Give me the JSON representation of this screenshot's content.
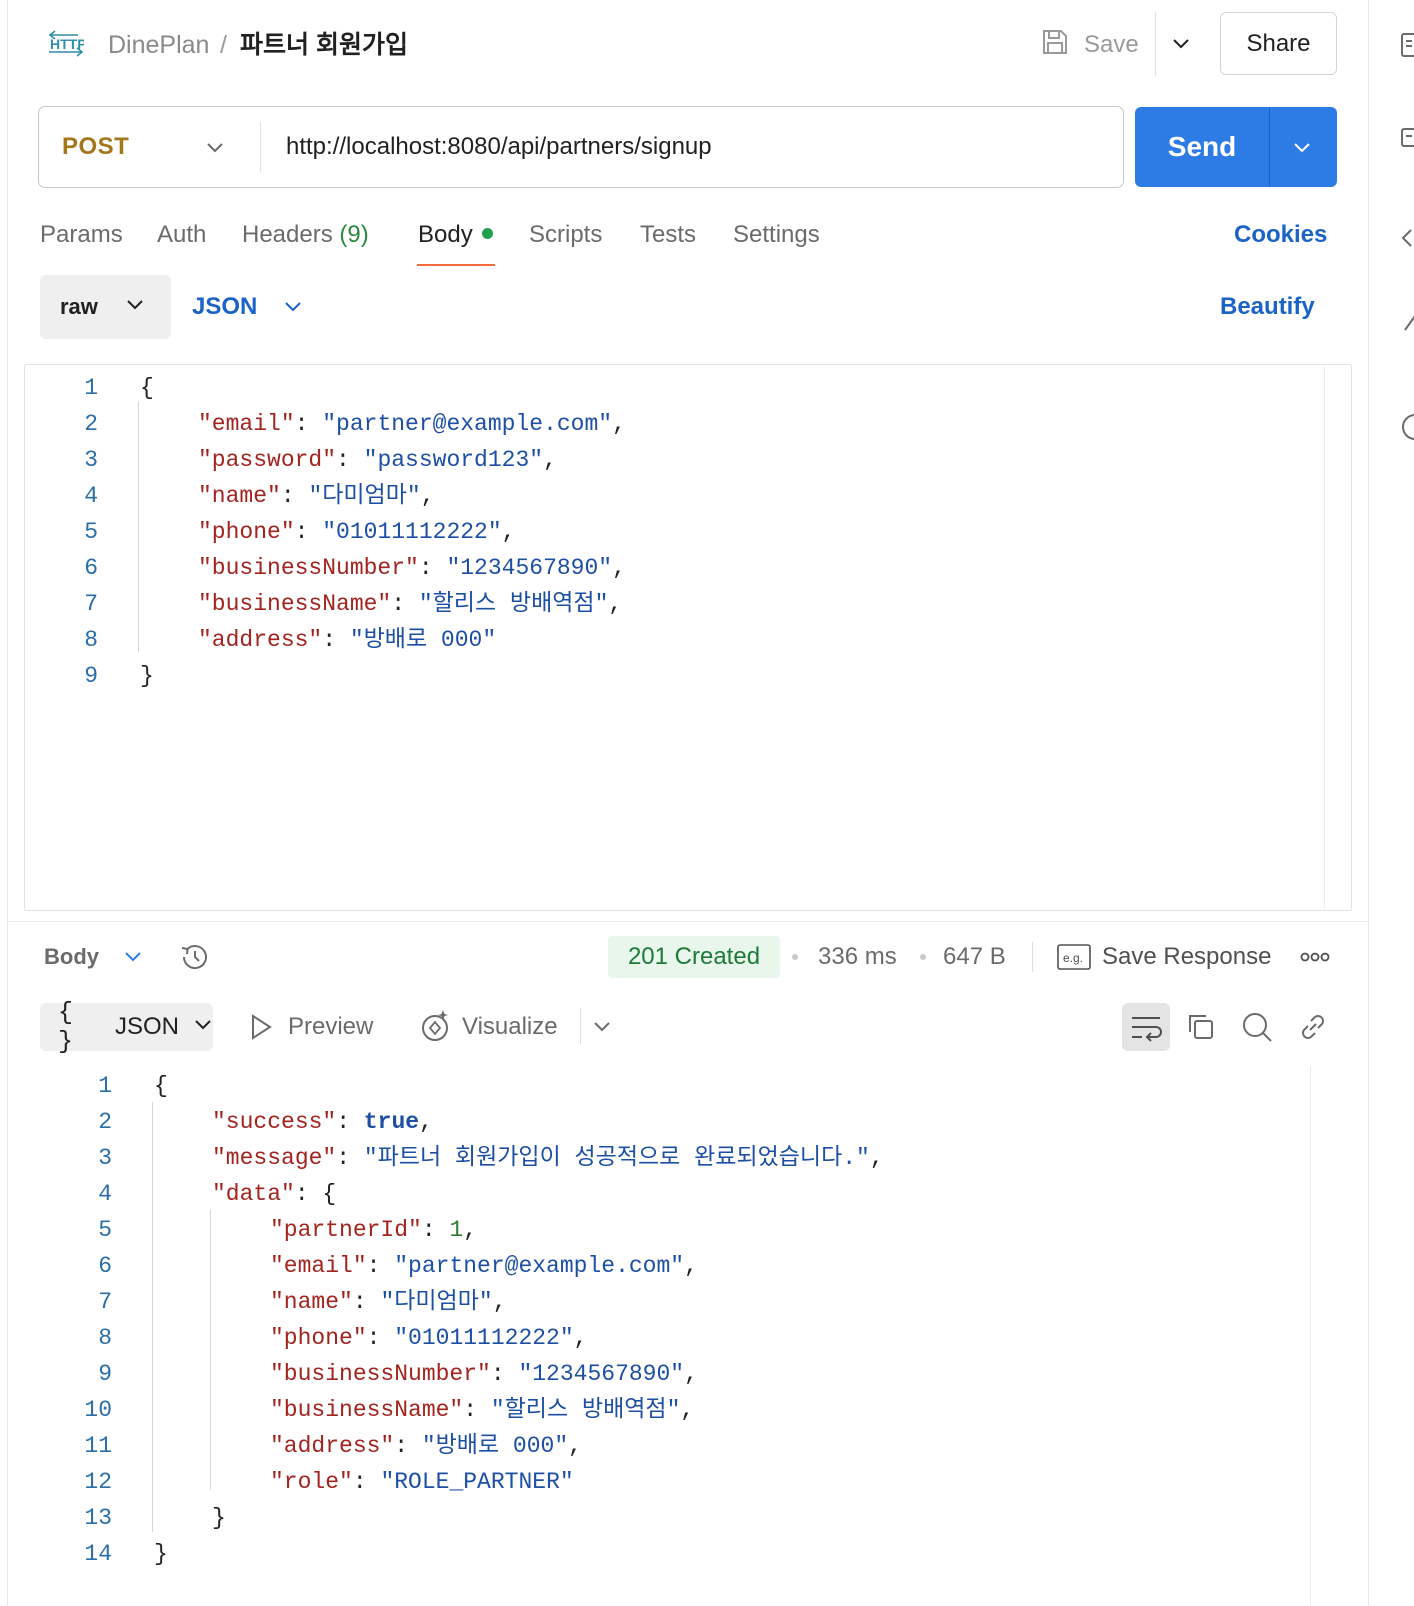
{
  "header": {
    "http_icon_label": "HTTP",
    "collection": "DinePlan",
    "separator": "/",
    "request_name": "파트너 회원가입",
    "save_label": "Save",
    "share_label": "Share"
  },
  "request": {
    "method": "POST",
    "url": "http://localhost:8080/api/partners/signup",
    "send_label": "Send"
  },
  "tabs": {
    "params": "Params",
    "auth": "Auth",
    "headers": "Headers",
    "headers_count": "(9)",
    "body": "Body",
    "scripts": "Scripts",
    "tests": "Tests",
    "settings": "Settings",
    "cookies": "Cookies"
  },
  "body_options": {
    "mode": "raw",
    "language": "JSON",
    "beautify": "Beautify"
  },
  "request_body_lines": [
    {
      "num": "1",
      "indent": 0,
      "parts": [
        {
          "t": "{",
          "c": "p"
        }
      ]
    },
    {
      "num": "2",
      "indent": 1,
      "parts": [
        {
          "t": "\"email\"",
          "c": "k"
        },
        {
          "t": ": ",
          "c": "p"
        },
        {
          "t": "\"partner@example.com\"",
          "c": "s"
        },
        {
          "t": ",",
          "c": "p"
        }
      ]
    },
    {
      "num": "3",
      "indent": 1,
      "parts": [
        {
          "t": "\"password\"",
          "c": "k"
        },
        {
          "t": ": ",
          "c": "p"
        },
        {
          "t": "\"password123\"",
          "c": "s"
        },
        {
          "t": ",",
          "c": "p"
        }
      ]
    },
    {
      "num": "4",
      "indent": 1,
      "parts": [
        {
          "t": "\"name\"",
          "c": "k"
        },
        {
          "t": ": ",
          "c": "p"
        },
        {
          "t": "\"다미엄마\"",
          "c": "s"
        },
        {
          "t": ",",
          "c": "p"
        }
      ]
    },
    {
      "num": "5",
      "indent": 1,
      "parts": [
        {
          "t": "\"phone\"",
          "c": "k"
        },
        {
          "t": ": ",
          "c": "p"
        },
        {
          "t": "\"01011112222\"",
          "c": "s"
        },
        {
          "t": ",",
          "c": "p"
        }
      ]
    },
    {
      "num": "6",
      "indent": 1,
      "parts": [
        {
          "t": "\"businessNumber\"",
          "c": "k"
        },
        {
          "t": ": ",
          "c": "p"
        },
        {
          "t": "\"1234567890\"",
          "c": "s"
        },
        {
          "t": ",",
          "c": "p"
        }
      ]
    },
    {
      "num": "7",
      "indent": 1,
      "parts": [
        {
          "t": "\"businessName\"",
          "c": "k"
        },
        {
          "t": ": ",
          "c": "p"
        },
        {
          "t": "\"할리스 방배역점\"",
          "c": "s"
        },
        {
          "t": ",",
          "c": "p"
        }
      ]
    },
    {
      "num": "8",
      "indent": 1,
      "parts": [
        {
          "t": "\"address\"",
          "c": "k"
        },
        {
          "t": ": ",
          "c": "p"
        },
        {
          "t": "\"방배로 000\"",
          "c": "s"
        }
      ]
    },
    {
      "num": "9",
      "indent": 0,
      "parts": [
        {
          "t": "}",
          "c": "p"
        }
      ]
    }
  ],
  "response": {
    "body_label": "Body",
    "status": "201 Created",
    "time": "336 ms",
    "size": "647 B",
    "eg_label": "e.g.",
    "save_response": "Save Response",
    "view_mode": "JSON",
    "view_braces": "{ }",
    "preview": "Preview",
    "visualize": "Visualize"
  },
  "response_body_lines": [
    {
      "num": "1",
      "indent": 0,
      "parts": [
        {
          "t": "{",
          "c": "p"
        }
      ]
    },
    {
      "num": "2",
      "indent": 1,
      "parts": [
        {
          "t": "\"success\"",
          "c": "k"
        },
        {
          "t": ": ",
          "c": "p"
        },
        {
          "t": "true",
          "c": "b"
        },
        {
          "t": ",",
          "c": "p"
        }
      ]
    },
    {
      "num": "3",
      "indent": 1,
      "parts": [
        {
          "t": "\"message\"",
          "c": "k"
        },
        {
          "t": ": ",
          "c": "p"
        },
        {
          "t": "\"파트너 회원가입이 성공적으로 완료되었습니다.\"",
          "c": "s"
        },
        {
          "t": ",",
          "c": "p"
        }
      ]
    },
    {
      "num": "4",
      "indent": 1,
      "parts": [
        {
          "t": "\"data\"",
          "c": "k"
        },
        {
          "t": ": {",
          "c": "p"
        }
      ]
    },
    {
      "num": "5",
      "indent": 2,
      "parts": [
        {
          "t": "\"partnerId\"",
          "c": "k"
        },
        {
          "t": ": ",
          "c": "p"
        },
        {
          "t": "1",
          "c": "n"
        },
        {
          "t": ",",
          "c": "p"
        }
      ]
    },
    {
      "num": "6",
      "indent": 2,
      "parts": [
        {
          "t": "\"email\"",
          "c": "k"
        },
        {
          "t": ": ",
          "c": "p"
        },
        {
          "t": "\"partner@example.com\"",
          "c": "s"
        },
        {
          "t": ",",
          "c": "p"
        }
      ]
    },
    {
      "num": "7",
      "indent": 2,
      "parts": [
        {
          "t": "\"name\"",
          "c": "k"
        },
        {
          "t": ": ",
          "c": "p"
        },
        {
          "t": "\"다미엄마\"",
          "c": "s"
        },
        {
          "t": ",",
          "c": "p"
        }
      ]
    },
    {
      "num": "8",
      "indent": 2,
      "parts": [
        {
          "t": "\"phone\"",
          "c": "k"
        },
        {
          "t": ": ",
          "c": "p"
        },
        {
          "t": "\"01011112222\"",
          "c": "s"
        },
        {
          "t": ",",
          "c": "p"
        }
      ]
    },
    {
      "num": "9",
      "indent": 2,
      "parts": [
        {
          "t": "\"businessNumber\"",
          "c": "k"
        },
        {
          "t": ": ",
          "c": "p"
        },
        {
          "t": "\"1234567890\"",
          "c": "s"
        },
        {
          "t": ",",
          "c": "p"
        }
      ]
    },
    {
      "num": "10",
      "indent": 2,
      "parts": [
        {
          "t": "\"businessName\"",
          "c": "k"
        },
        {
          "t": ": ",
          "c": "p"
        },
        {
          "t": "\"할리스 방배역점\"",
          "c": "s"
        },
        {
          "t": ",",
          "c": "p"
        }
      ]
    },
    {
      "num": "11",
      "indent": 2,
      "parts": [
        {
          "t": "\"address\"",
          "c": "k"
        },
        {
          "t": ": ",
          "c": "p"
        },
        {
          "t": "\"방배로 000\"",
          "c": "s"
        },
        {
          "t": ",",
          "c": "p"
        }
      ]
    },
    {
      "num": "12",
      "indent": 2,
      "parts": [
        {
          "t": "\"role\"",
          "c": "k"
        },
        {
          "t": ": ",
          "c": "p"
        },
        {
          "t": "\"ROLE_PARTNER\"",
          "c": "s"
        }
      ]
    },
    {
      "num": "13",
      "indent": 1,
      "parts": [
        {
          "t": "}",
          "c": "p"
        }
      ]
    },
    {
      "num": "14",
      "indent": 0,
      "parts": [
        {
          "t": "}",
          "c": "p"
        }
      ]
    }
  ],
  "icons": {
    "http": "http-request-icon",
    "save": "floppy-disk-icon",
    "chevron": "chevron-down-icon",
    "history": "history-clock-icon",
    "save_response": "eg-example-icon",
    "more": "more-horizontal-icon",
    "preview": "play-triangle-icon",
    "visualize": "visualize-sparkle-icon",
    "wrap": "wrap-lines-icon",
    "copy": "copy-icon",
    "search": "search-icon",
    "link": "link-icon"
  },
  "colors": {
    "send_button": "#2d7be5",
    "method": "#a4771d",
    "link_blue": "#1b63c7",
    "active_tab_underline": "#f26b3a",
    "body_dot": "#21a14b",
    "status_bg": "#e9f6ec",
    "status_text": "#1d7a3a",
    "json_key": "#a3241f",
    "json_string": "#1d4fa5"
  }
}
